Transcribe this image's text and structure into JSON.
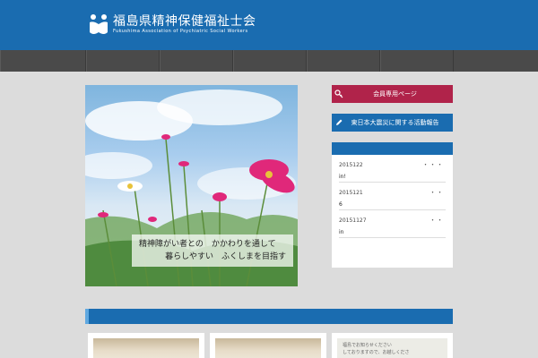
{
  "header": {
    "title_jp": "福島県精神保健福祉士会",
    "title_en": "Fukushima Association of Psychiatric Social Workers",
    "bg_color": "#1a6cb0"
  },
  "nav": {
    "items": [
      "",
      "",
      "",
      "",
      "",
      ""
    ]
  },
  "hero": {
    "line1": "精神障がい者との　かかわりを通して",
    "line2": "暮らしやすい　ふくしまを目指す"
  },
  "sidebar": {
    "member_button": {
      "label": "会員専用ページ",
      "icon": "key-icon",
      "color": "#b0234a"
    },
    "report_button": {
      "label": "東日本大震災に関する活動報告",
      "icon": "pencil-icon",
      "color": "#1a6cb0"
    },
    "news": [
      {
        "date": "2015122",
        "title": "in!",
        "more": "・・・"
      },
      {
        "date": "2015121",
        "title": "6",
        "more": "・・"
      },
      {
        "date": "20151127",
        "title": "in",
        "more": "・・"
      },
      {
        "date": "",
        "title": "",
        "more": ""
      }
    ]
  },
  "cards": [
    {
      "text": ""
    },
    {
      "text": ""
    },
    {
      "line1": "福島でお知らせください",
      "line2": "しておりますので、お越しくださ"
    }
  ]
}
